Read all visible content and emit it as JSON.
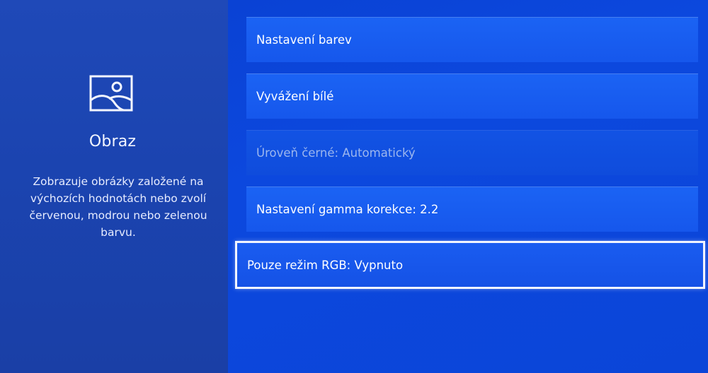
{
  "sidebar": {
    "icon": "picture-icon",
    "title": "Obraz",
    "description": "Zobrazuje obrázky založené na výchozích hodnotách nebo zvolí červenou, modrou nebo zelenou barvu."
  },
  "menu": {
    "items": [
      {
        "label": "Nastavení barev",
        "state": "normal"
      },
      {
        "label": "Vyvážení bílé",
        "state": "normal"
      },
      {
        "label": "Úroveň černé: Automatický",
        "state": "disabled"
      },
      {
        "label": "Nastavení gamma korekce: 2.2",
        "state": "normal"
      },
      {
        "label": "Pouze režim RGB: Vypnuto",
        "state": "focused"
      }
    ]
  },
  "colors": {
    "left_panel": "#1d46b4",
    "right_panel": "#0b45d8",
    "item_bg": "#1a5ef2",
    "focus_border": "#f1f4ff",
    "disabled_text": "#9cb6ee"
  }
}
